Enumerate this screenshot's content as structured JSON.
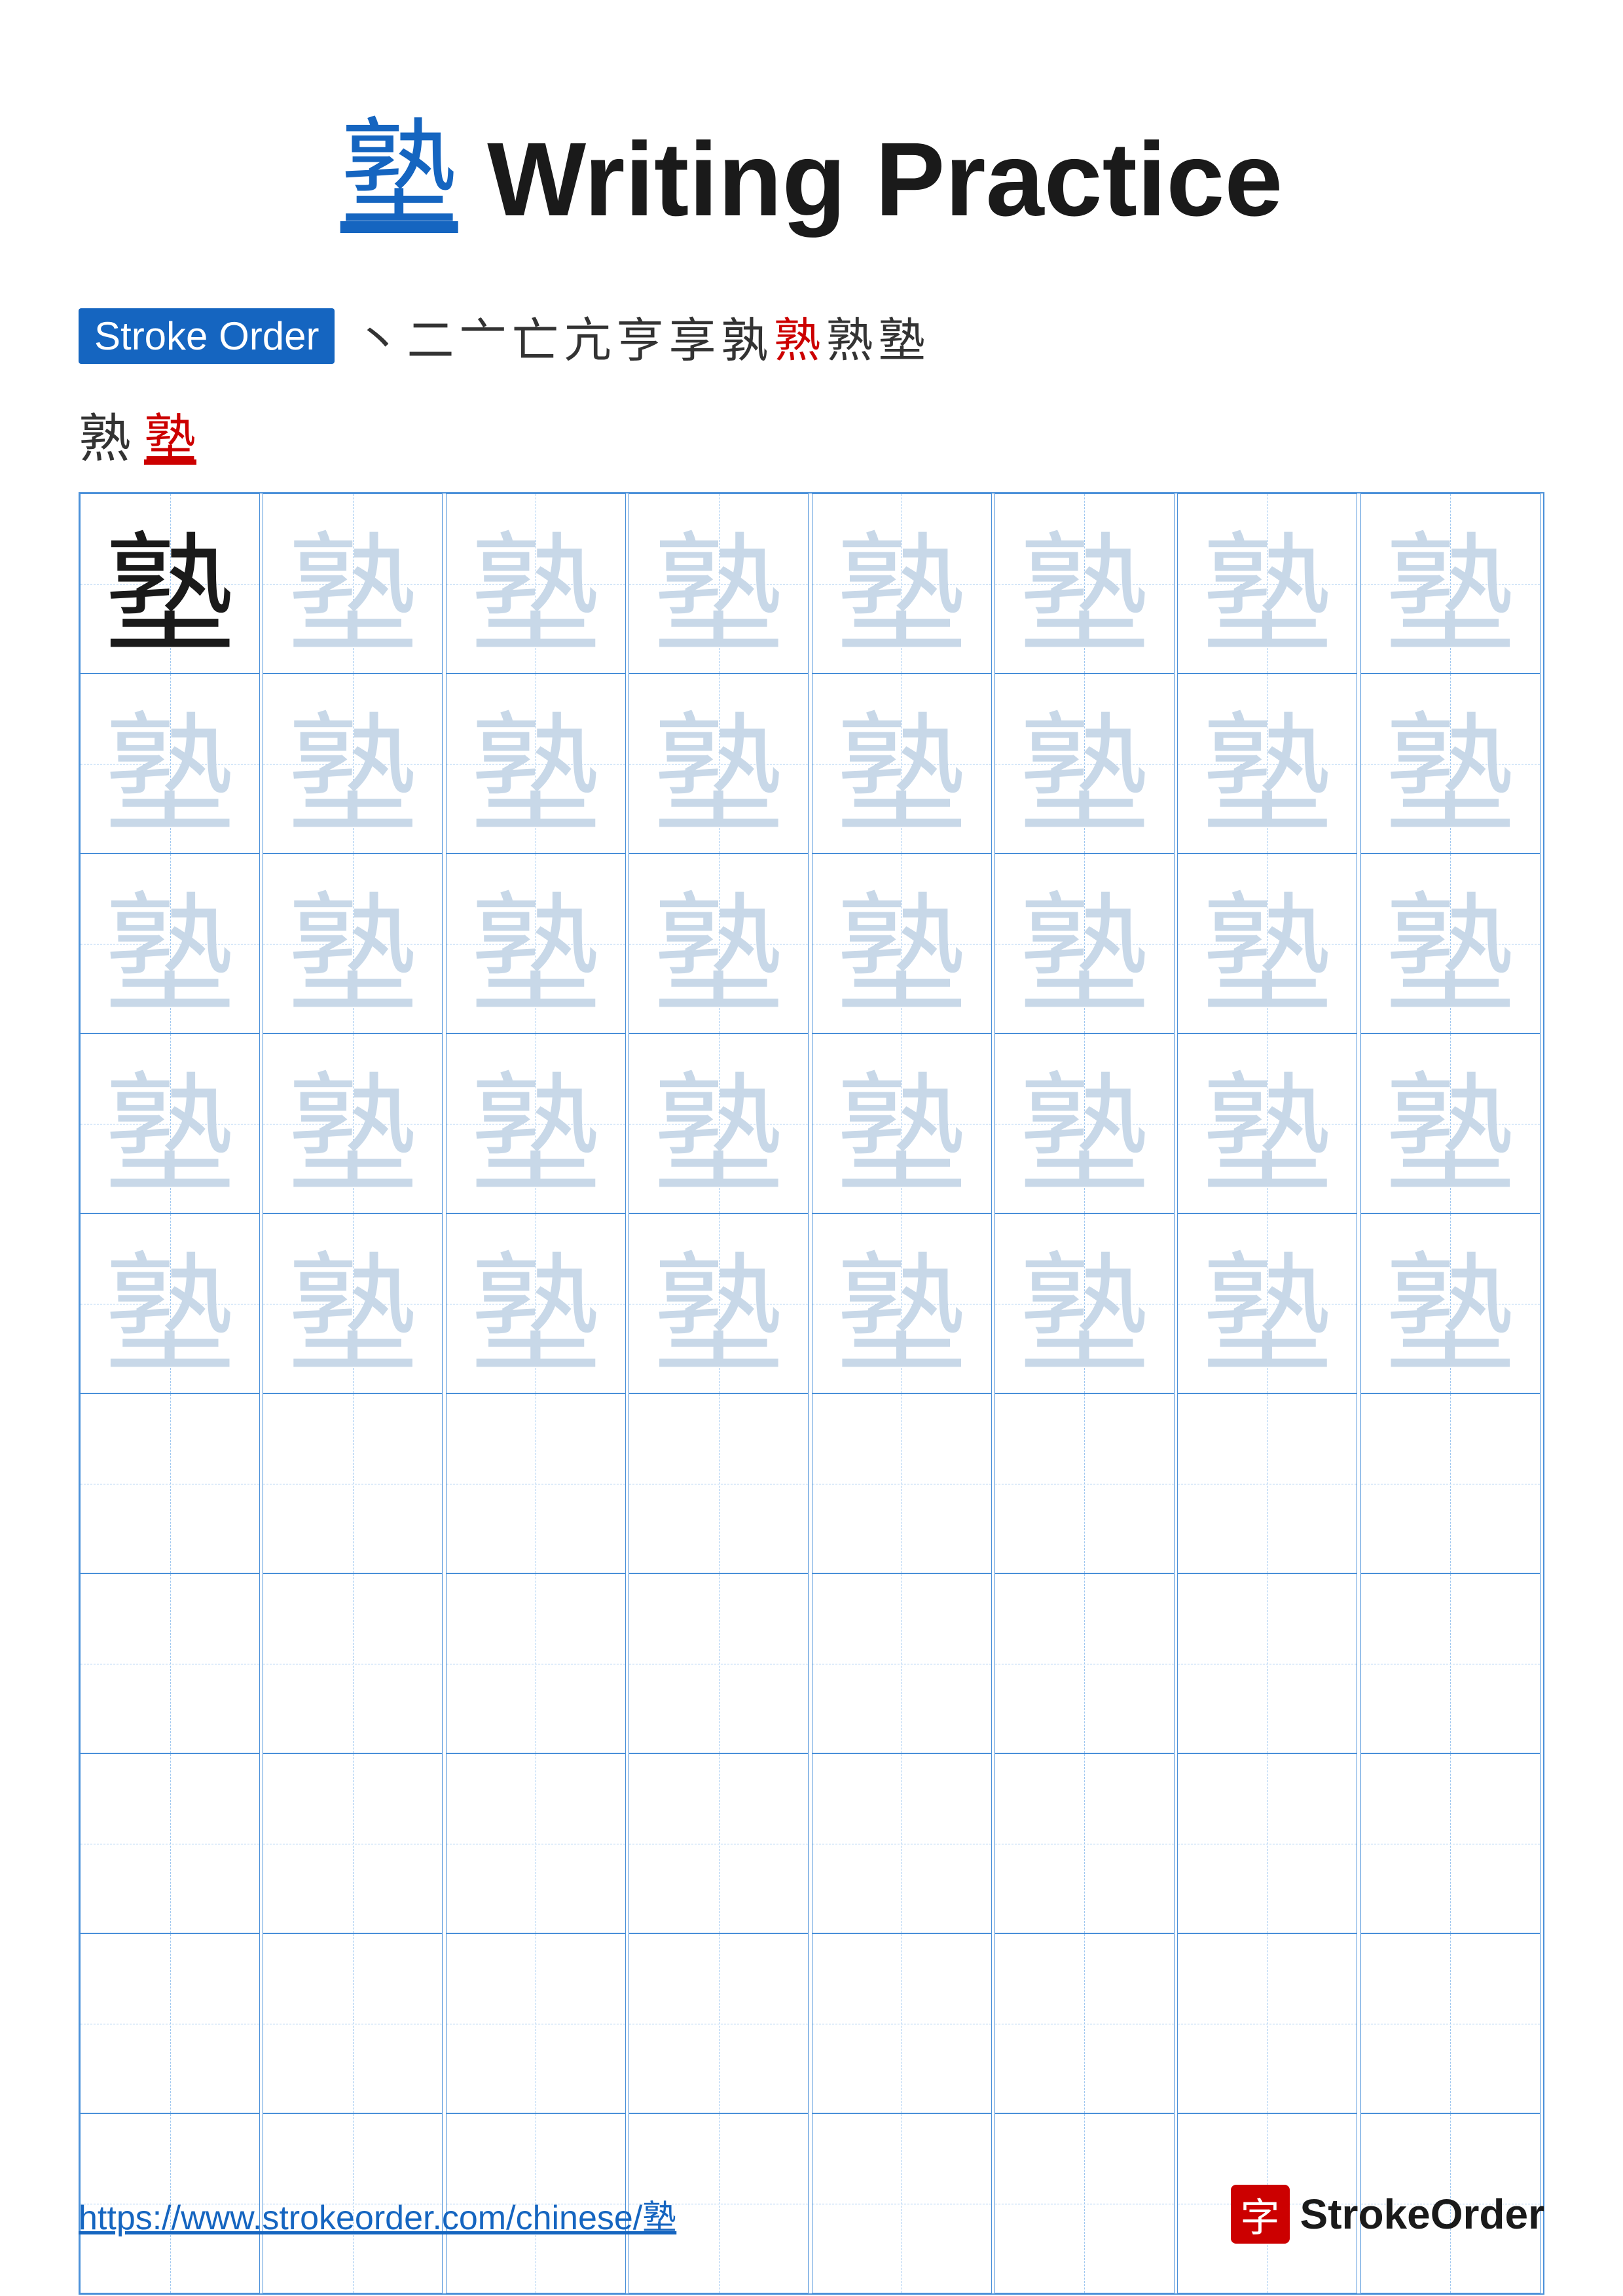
{
  "title": {
    "char": "塾",
    "text": " Writing Practice"
  },
  "stroke_order": {
    "label": "Stroke Order",
    "chars": [
      "丶",
      "二",
      "亠",
      "亡",
      "亢",
      "亨",
      "享",
      "孰",
      "熟",
      "熟",
      "塾"
    ],
    "row2": [
      "熟",
      "塾"
    ]
  },
  "grid": {
    "char": "塾",
    "rows": 10,
    "cols": 8
  },
  "footer": {
    "url": "https://www.strokeorder.com/chinese/塾",
    "logo_char": "字",
    "logo_text": "StrokeOrder"
  }
}
